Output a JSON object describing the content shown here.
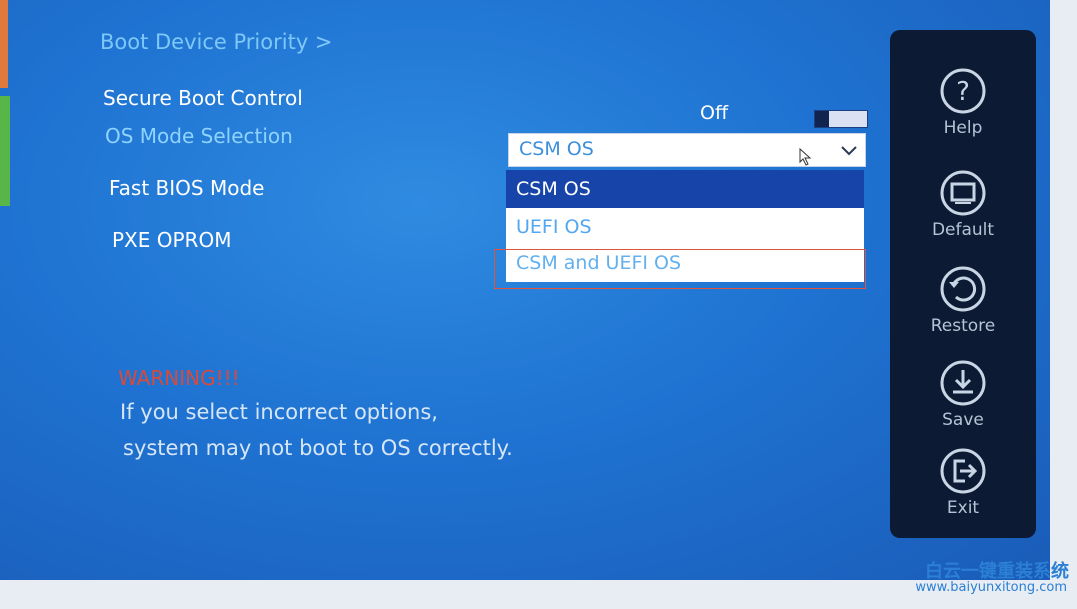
{
  "breadcrumb": "Boot Device Priority >",
  "settings": {
    "secure_boot_label": "Secure Boot Control",
    "secure_boot_value": "Off",
    "os_mode_label": "OS Mode Selection",
    "fast_bios_label": "Fast BIOS Mode",
    "pxe_label": "PXE OPROM"
  },
  "os_mode_dropdown": {
    "selected": "CSM OS",
    "options": [
      "CSM OS",
      "UEFI OS",
      "CSM and UEFI OS"
    ]
  },
  "warning": {
    "title": "WARNING!!!",
    "line1": "If you select incorrect options,",
    "line2": "system may not boot to OS correctly."
  },
  "sidebar": {
    "help": "Help",
    "default": "Default",
    "restore": "Restore",
    "save": "Save",
    "exit": "Exit"
  },
  "watermark": {
    "brand": "白云一键重装系统",
    "url": "www.baiyunxitong.com"
  },
  "colors": {
    "screen_blue": "#1f73d2",
    "selected_option": "#1744a8",
    "warning_red": "#d84a3a",
    "sidebar_bg": "#0c1a33",
    "highlight_box": "#e0543a"
  }
}
